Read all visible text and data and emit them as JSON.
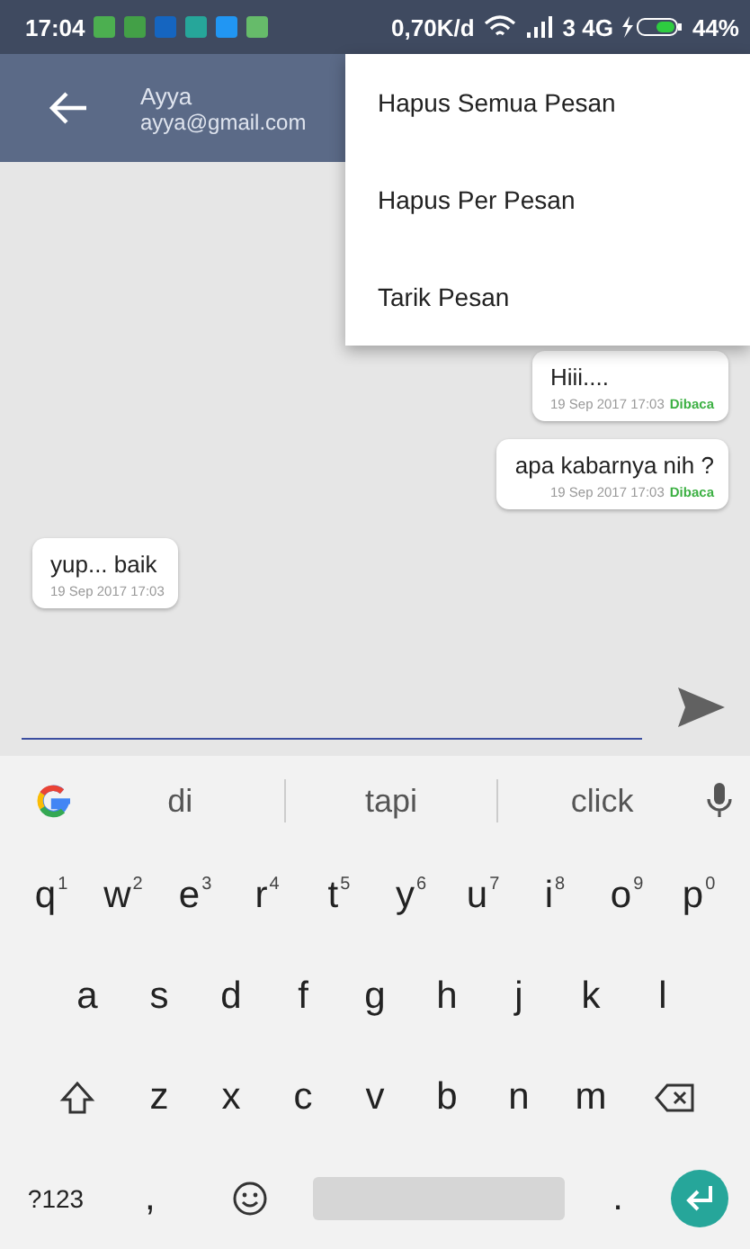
{
  "status_bar": {
    "time": "17:04",
    "speed": "0,70K/d",
    "network": "3 4G",
    "battery": "44%"
  },
  "app_bar": {
    "name": "Ayya",
    "email": "ayya@gmail.com"
  },
  "menu": [
    "Hapus Semua Pesan",
    "Hapus Per Pesan",
    "Tarik Pesan"
  ],
  "messages": [
    {
      "kind": "outgoing",
      "text": "Hiii....",
      "time": "19 Sep 2017 17:03",
      "status": "Dibaca"
    },
    {
      "kind": "outgoing",
      "text": "apa kabarnya nih ?",
      "time": "19 Sep 2017 17:03",
      "status": "Dibaca"
    },
    {
      "kind": "incoming",
      "text": "yup... baik",
      "time": "19 Sep 2017 17:03"
    }
  ],
  "keyboard": {
    "suggestions": [
      "di",
      "tapi",
      "click"
    ],
    "rows": [
      [
        {
          "label": "q",
          "hint": "1"
        },
        {
          "label": "w",
          "hint": "2"
        },
        {
          "label": "e",
          "hint": "3"
        },
        {
          "label": "r",
          "hint": "4"
        },
        {
          "label": "t",
          "hint": "5"
        },
        {
          "label": "y",
          "hint": "6"
        },
        {
          "label": "u",
          "hint": "7"
        },
        {
          "label": "i",
          "hint": "8"
        },
        {
          "label": "o",
          "hint": "9"
        },
        {
          "label": "p",
          "hint": "0"
        }
      ],
      [
        {
          "label": "a"
        },
        {
          "label": "s"
        },
        {
          "label": "d"
        },
        {
          "label": "f"
        },
        {
          "label": "g"
        },
        {
          "label": "h"
        },
        {
          "label": "j"
        },
        {
          "label": "k"
        },
        {
          "label": "l"
        }
      ],
      [
        {
          "label": "z"
        },
        {
          "label": "x"
        },
        {
          "label": "c"
        },
        {
          "label": "v"
        },
        {
          "label": "b"
        },
        {
          "label": "n"
        },
        {
          "label": "m"
        }
      ]
    ],
    "symbols_key": "?123",
    "comma_key": ",",
    "period_key": "."
  }
}
